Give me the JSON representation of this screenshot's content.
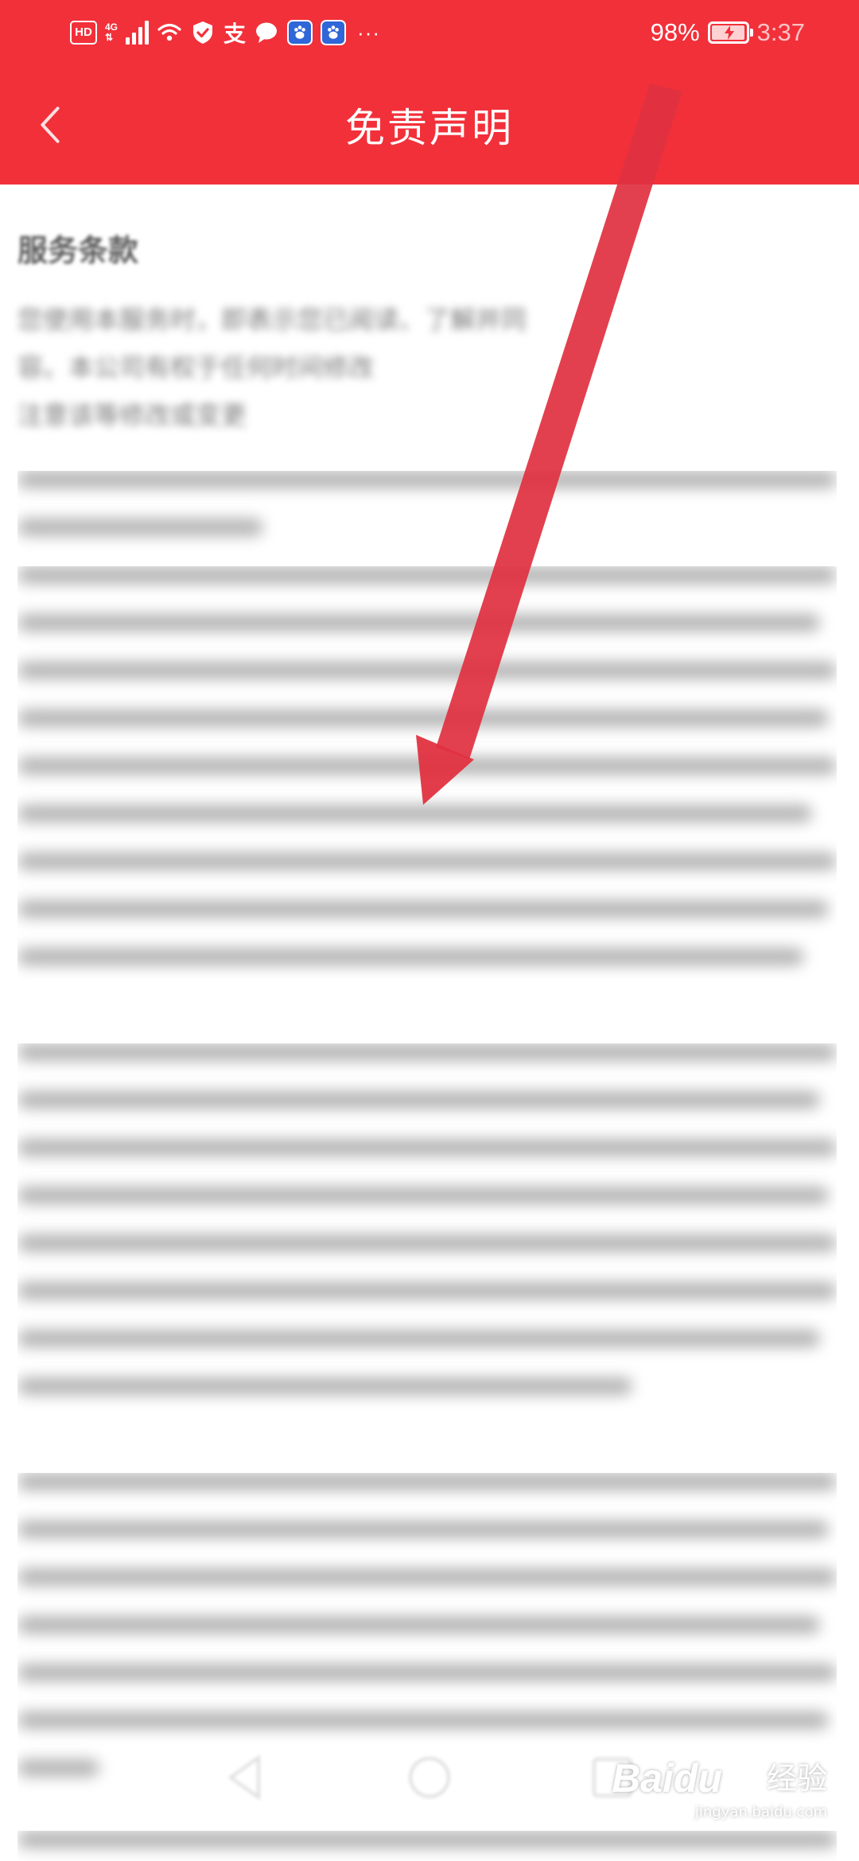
{
  "status_bar": {
    "hd_label": "HD",
    "network_label": "4G",
    "zhi_label": "支",
    "more_label": "···",
    "battery_percent": "98%",
    "battery_level": 0.98,
    "time": "3:37"
  },
  "header": {
    "title": "免责声明"
  },
  "content": {
    "heading": "服务条款",
    "visible_text_line1": "您使用本服务时，即表示您已阅读、了解并同",
    "visible_text_line2": "容。本公司有权于任何时间修改",
    "visible_text_line3": "注意该等修改或变更"
  },
  "watermark": {
    "logo": "Baidu",
    "label": "经验",
    "url": "jingyan.baidu.com"
  },
  "colors": {
    "header_red": "#f2303a",
    "arrow_red": "#e03241",
    "text_gray": "#777777"
  }
}
